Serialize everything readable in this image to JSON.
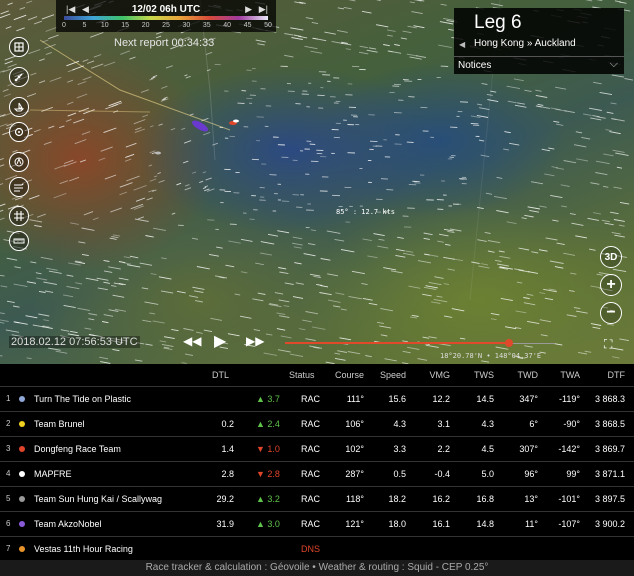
{
  "scale": {
    "time": "12/02 06h UTC",
    "ticks": [
      "0",
      "5",
      "10",
      "15",
      "20",
      "25",
      "30",
      "35",
      "40",
      "45",
      "50"
    ]
  },
  "next_report": "Next report 00:34:33",
  "leg": {
    "title": "Leg 6",
    "route": "Hong Kong » Auckland",
    "notices_label": "Notices"
  },
  "tools": [
    {
      "icon": "layers-icon"
    },
    {
      "icon": "satellite-icon"
    },
    {
      "icon": "boat-icon"
    },
    {
      "icon": "ship-wheel-icon"
    },
    {
      "icon": "compass-icon"
    },
    {
      "icon": "wind-icon"
    },
    {
      "icon": "grid-icon"
    },
    {
      "icon": "ruler-icon"
    }
  ],
  "controls": {
    "view_3d": "3D",
    "zoom_in": "+",
    "zoom_out": "−"
  },
  "map": {
    "timestamp": "2018.02.12 07:56:53 UTC",
    "wind_readout": "85° : 12.7 kts",
    "coords": "18°20.78'N • 148°04.37'E",
    "timeline_progress": 0.83
  },
  "table": {
    "headers": {
      "dtl": "DTL",
      "status": "Status",
      "course": "Course",
      "speed": "Speed",
      "vmg": "VMG",
      "tws": "TWS",
      "twd": "TWD",
      "twa": "TWA",
      "dtf": "DTF"
    },
    "rows": [
      {
        "rank": "1",
        "color": "#8fa8d8",
        "name": "Turn The Tide on Plastic",
        "dtl": "",
        "delta": "▲ 3.7",
        "dir": "up",
        "status": "RAC",
        "course": "111°",
        "speed": "15.6",
        "vmg": "12.2",
        "tws": "14.5",
        "twd": "347°",
        "twa": "-119°",
        "dtf": "3 868.3"
      },
      {
        "rank": "2",
        "color": "#f0d020",
        "name": "Team Brunel",
        "dtl": "0.2",
        "delta": "▲ 2.4",
        "dir": "up",
        "status": "RAC",
        "course": "106°",
        "speed": "4.3",
        "vmg": "3.1",
        "tws": "4.3",
        "twd": "6°",
        "twa": "-90°",
        "dtf": "3 868.5"
      },
      {
        "rank": "3",
        "color": "#e0452a",
        "name": "Dongfeng Race Team",
        "dtl": "1.4",
        "delta": "▼ 1.0",
        "dir": "down",
        "status": "RAC",
        "course": "102°",
        "speed": "3.3",
        "vmg": "2.2",
        "tws": "4.5",
        "twd": "307°",
        "twa": "-142°",
        "dtf": "3 869.7"
      },
      {
        "rank": "4",
        "color": "#ffffff",
        "name": "MAPFRE",
        "dtl": "2.8",
        "delta": "▼ 2.8",
        "dir": "down",
        "status": "RAC",
        "course": "287°",
        "speed": "0.5",
        "vmg": "-0.4",
        "tws": "5.0",
        "twd": "96°",
        "twa": "99°",
        "dtf": "3 871.1"
      },
      {
        "rank": "5",
        "color": "#9a9a9a",
        "name": "Team Sun Hung Kai / Scallywag",
        "dtl": "29.2",
        "delta": "▲ 3.2",
        "dir": "up",
        "status": "RAC",
        "course": "118°",
        "speed": "18.2",
        "vmg": "16.2",
        "tws": "16.8",
        "twd": "13°",
        "twa": "-101°",
        "dtf": "3 897.5"
      },
      {
        "rank": "6",
        "color": "#8a5ad8",
        "name": "Team AkzoNobel",
        "dtl": "31.9",
        "delta": "▲ 3.0",
        "dir": "up",
        "status": "RAC",
        "course": "121°",
        "speed": "18.0",
        "vmg": "16.1",
        "tws": "14.8",
        "twd": "11°",
        "twa": "-107°",
        "dtf": "3 900.2"
      },
      {
        "rank": "7",
        "color": "#e8942a",
        "name": "Vestas 11th Hour Racing",
        "dtl": "",
        "delta": "",
        "dir": "",
        "status": "DNS",
        "course": "",
        "speed": "",
        "vmg": "",
        "tws": "",
        "twd": "",
        "twa": "",
        "dtf": ""
      }
    ]
  },
  "footer": "Race tracker & calculation : Géovoile • Weather & routing : Squid - CEP 0.25°"
}
